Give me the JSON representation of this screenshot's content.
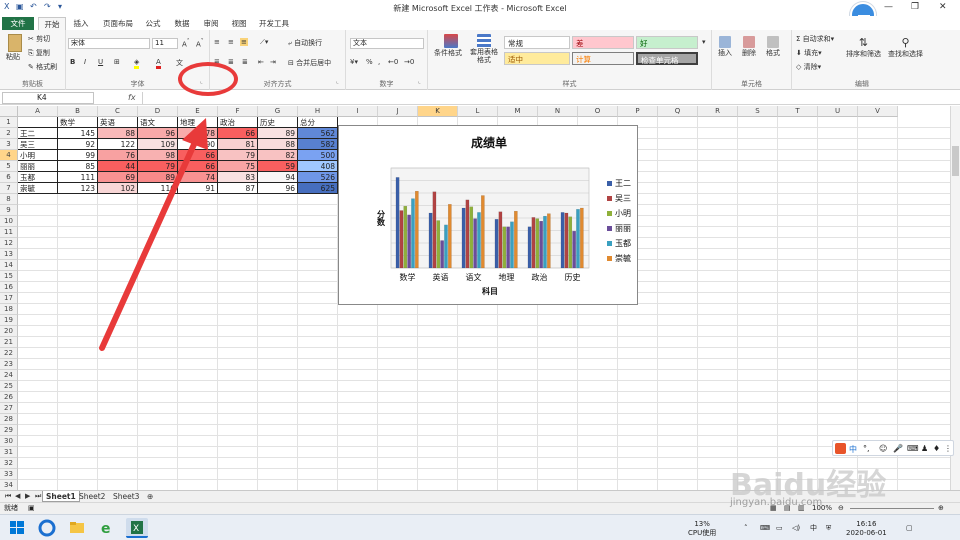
{
  "window": {
    "title": "新建 Microsoft Excel 工作表 - Microsoft Excel",
    "buttons": {
      "minimize": "—",
      "restore": "❐",
      "close": "✕"
    }
  },
  "tabs": [
    {
      "label": "文件"
    },
    {
      "label": "开始"
    },
    {
      "label": "插入"
    },
    {
      "label": "页面布局"
    },
    {
      "label": "公式"
    },
    {
      "label": "数据"
    },
    {
      "label": "审阅"
    },
    {
      "label": "视图"
    },
    {
      "label": "开发工具"
    }
  ],
  "ribbon": {
    "clipboard": {
      "paste": "粘贴",
      "cut": "剪切",
      "copy": "复制",
      "format_painter": "格式刷",
      "label": "剪贴板"
    },
    "font": {
      "name": "宋体",
      "size": "11",
      "label": "字体"
    },
    "alignment": {
      "wrap": "自动换行",
      "merge": "合并后居中",
      "label": "对齐方式"
    },
    "number": {
      "format": "文本",
      "label": "数字"
    },
    "styles": {
      "conditional": "条件格式",
      "table": "套用表格格式",
      "normal": "常规",
      "bad": "差",
      "good": "好",
      "neutral": "适中",
      "calc": "计算",
      "check": "检查单元格",
      "label": "样式"
    },
    "cells": {
      "insert": "插入",
      "delete": "删除",
      "format": "格式",
      "label": "单元格"
    },
    "editing": {
      "autosum": "自动求和",
      "fill": "填充",
      "clear": "清除",
      "sort": "排序和筛选",
      "find": "查找和选择",
      "label": "编辑"
    }
  },
  "formula_bar": {
    "name_box": "K4",
    "fx": "fx"
  },
  "columns": [
    "A",
    "B",
    "C",
    "D",
    "E",
    "F",
    "G",
    "H",
    "I",
    "J",
    "K",
    "L",
    "M",
    "N",
    "O",
    "P",
    "Q",
    "R",
    "S",
    "T",
    "U",
    "V"
  ],
  "rows": [
    "1",
    "2",
    "3",
    "4",
    "5",
    "6",
    "7",
    "8",
    "9",
    "10",
    "11",
    "12",
    "13",
    "14",
    "15",
    "16",
    "17",
    "18",
    "19",
    "20",
    "21",
    "22",
    "23",
    "24",
    "25",
    "26",
    "27",
    "28",
    "29",
    "30",
    "31",
    "32",
    "33",
    "34"
  ],
  "table": {
    "header": [
      "",
      "数学",
      "英语",
      "语文",
      "地理",
      "政治",
      "历史",
      "总分"
    ],
    "rows": [
      [
        "王二",
        "145",
        "88",
        "96",
        "78",
        "66",
        "89",
        "562"
      ],
      [
        "吴三",
        "92",
        "122",
        "109",
        "90",
        "81",
        "88",
        "582"
      ],
      [
        "小明",
        "99",
        "76",
        "98",
        "66",
        "79",
        "82",
        "500"
      ],
      [
        "丽丽",
        "85",
        "44",
        "79",
        "66",
        "75",
        "59",
        "408"
      ],
      [
        "玉都",
        "111",
        "69",
        "89",
        "74",
        "83",
        "94",
        "526"
      ],
      [
        "崇毓",
        "123",
        "102",
        "116",
        "91",
        "87",
        "96",
        "625"
      ]
    ]
  },
  "chart_data": {
    "type": "bar",
    "title": "成绩单",
    "xlabel": "科目",
    "ylabel": "分数",
    "categories": [
      "数学",
      "英语",
      "语文",
      "地理",
      "政治",
      "历史"
    ],
    "ylim": [
      0,
      160
    ],
    "grid": true,
    "legend": "right",
    "series": [
      {
        "name": "王二",
        "values": [
          145,
          88,
          96,
          78,
          66,
          89
        ],
        "color": "#3a5fa8"
      },
      {
        "name": "吴三",
        "values": [
          92,
          122,
          109,
          90,
          81,
          88
        ],
        "color": "#b04343"
      },
      {
        "name": "小明",
        "values": [
          99,
          76,
          98,
          66,
          79,
          82
        ],
        "color": "#8fb03a"
      },
      {
        "name": "丽丽",
        "values": [
          85,
          44,
          79,
          66,
          75,
          59
        ],
        "color": "#6a4d9a"
      },
      {
        "name": "玉都",
        "values": [
          111,
          69,
          89,
          74,
          83,
          94
        ],
        "color": "#3aa0c0"
      },
      {
        "name": "崇毓",
        "values": [
          123,
          102,
          116,
          91,
          87,
          96
        ],
        "color": "#e08a30"
      }
    ]
  },
  "sheets": [
    "Sheet1",
    "Sheet2",
    "Sheet3"
  ],
  "status": {
    "mode": "就绪",
    "zoom": "100%"
  },
  "taskbar": {
    "cpu_percent": "13%",
    "cpu_label": "CPU使用",
    "time": "16:16",
    "date": "2020-06-01"
  },
  "ime": {
    "lang": "中"
  },
  "watermark": {
    "brand": "Baidu经验",
    "url": "jingyan.baidu.com"
  },
  "colors": {
    "excel_green": "#217346",
    "red_annotation": "#e83a3a",
    "select_header": "#ffd58a"
  }
}
